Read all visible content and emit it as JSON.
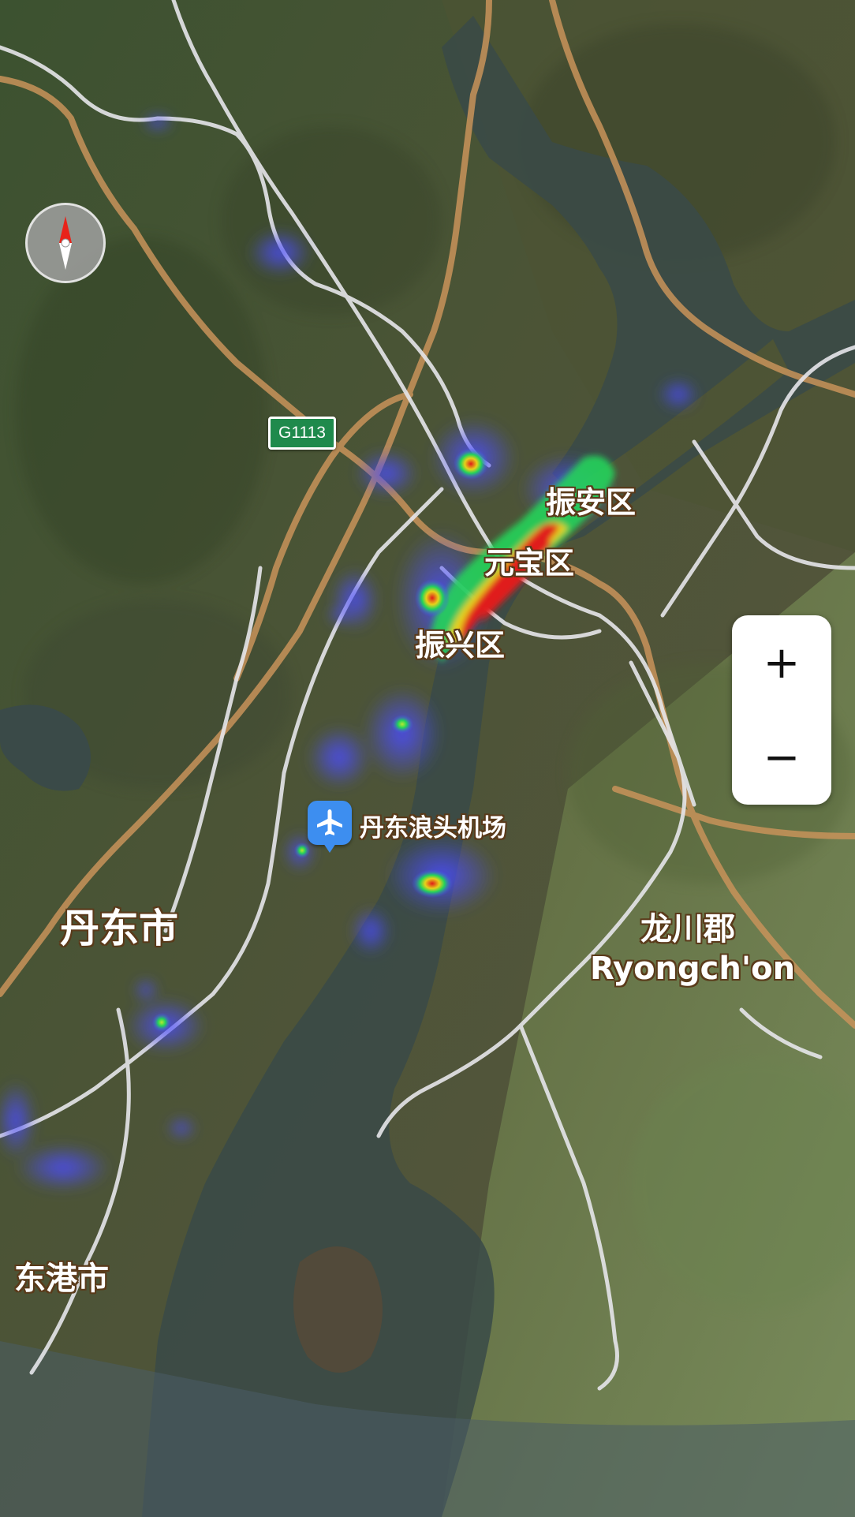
{
  "map": {
    "type": "satellite-heatmap",
    "highway_shield": "G1113",
    "places": {
      "zhenan": "振安区",
      "yuanbao": "元宝区",
      "zhenxing": "振兴区",
      "dandong": "丹东市",
      "donggang": "东港市",
      "ryongchon_cn": "龙川郡",
      "ryongchon_en": "Ryongch'on",
      "airport": "丹东浪头机场"
    },
    "icons": {
      "compass": "compass-icon",
      "airport": "airplane-icon"
    },
    "colors": {
      "highway": "#c8935a",
      "road": "#e6e6ea",
      "river": "#3a4a48",
      "heat_low": "#4b4cff",
      "heat_mid": "#22d35a",
      "heat_high": "#e01a1a",
      "airport_pin": "#3d8ef0",
      "shield": "#1f8a4c"
    }
  },
  "controls": {
    "zoom_in": "+",
    "zoom_out": "−"
  }
}
